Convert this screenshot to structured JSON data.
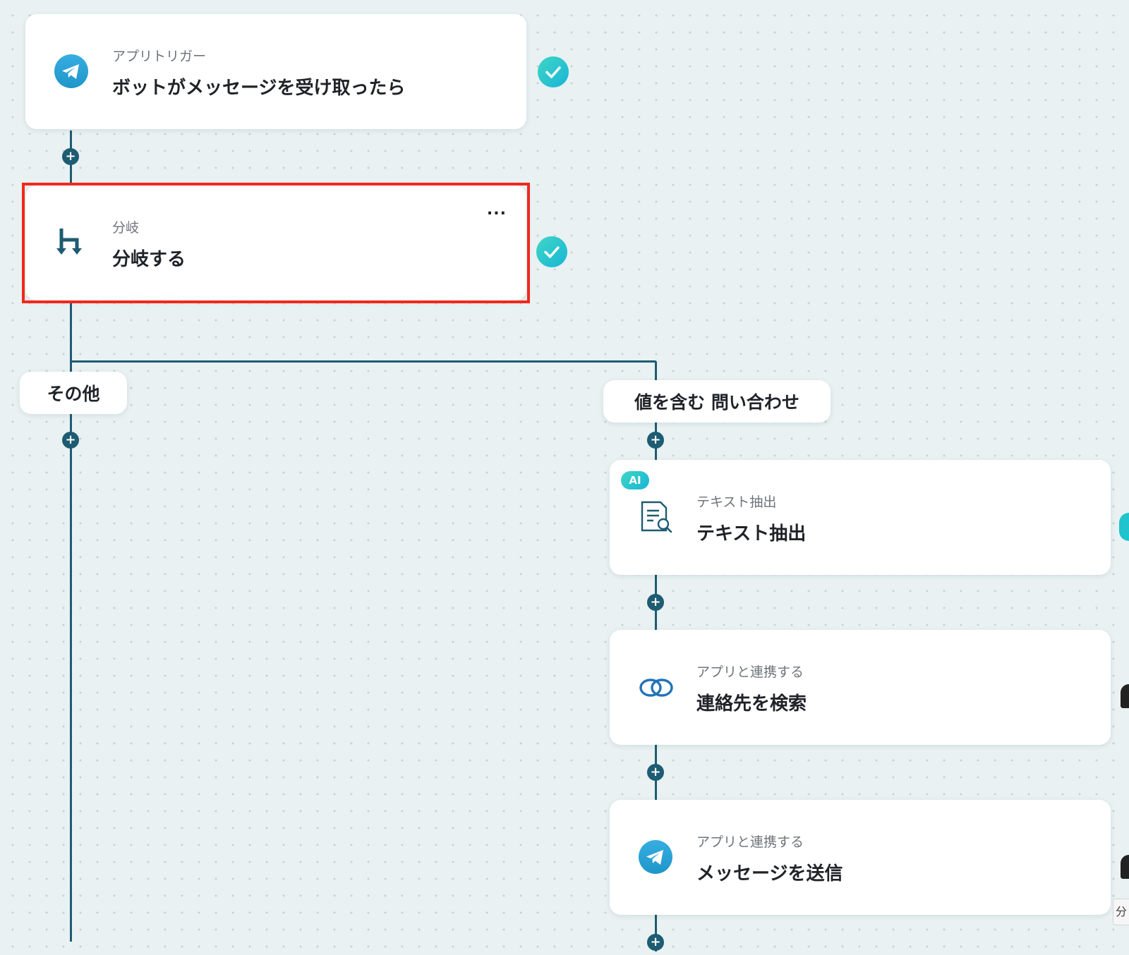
{
  "trigger_card": {
    "subtitle": "アプリトリガー",
    "title": "ボットがメッセージを受け取ったら",
    "icon": "telegram-icon"
  },
  "branch_card": {
    "subtitle": "分岐",
    "title": "分岐する",
    "icon": "branch-icon",
    "menu_label": "..."
  },
  "branches": {
    "left_label": "その他",
    "right_label": "値を含む 問い合わせ"
  },
  "text_extract_card": {
    "badge": "AI",
    "subtitle": "テキスト抽出",
    "title": "テキスト抽出",
    "icon": "document-search-icon"
  },
  "contact_search_card": {
    "subtitle": "アプリと連携する",
    "title": "連絡先を検索",
    "icon": "link-rings-icon"
  },
  "send_message_card": {
    "subtitle": "アプリと連携する",
    "title": "メッセージを送信",
    "icon": "telegram-icon"
  },
  "add_step_symbol": "+",
  "edge_tag": "分",
  "colors": {
    "connector": "#1d5c72",
    "selection": "#f1291c",
    "check": "#1fc4cf",
    "telegram": "#2aa3df",
    "background": "#e9f1f2"
  }
}
